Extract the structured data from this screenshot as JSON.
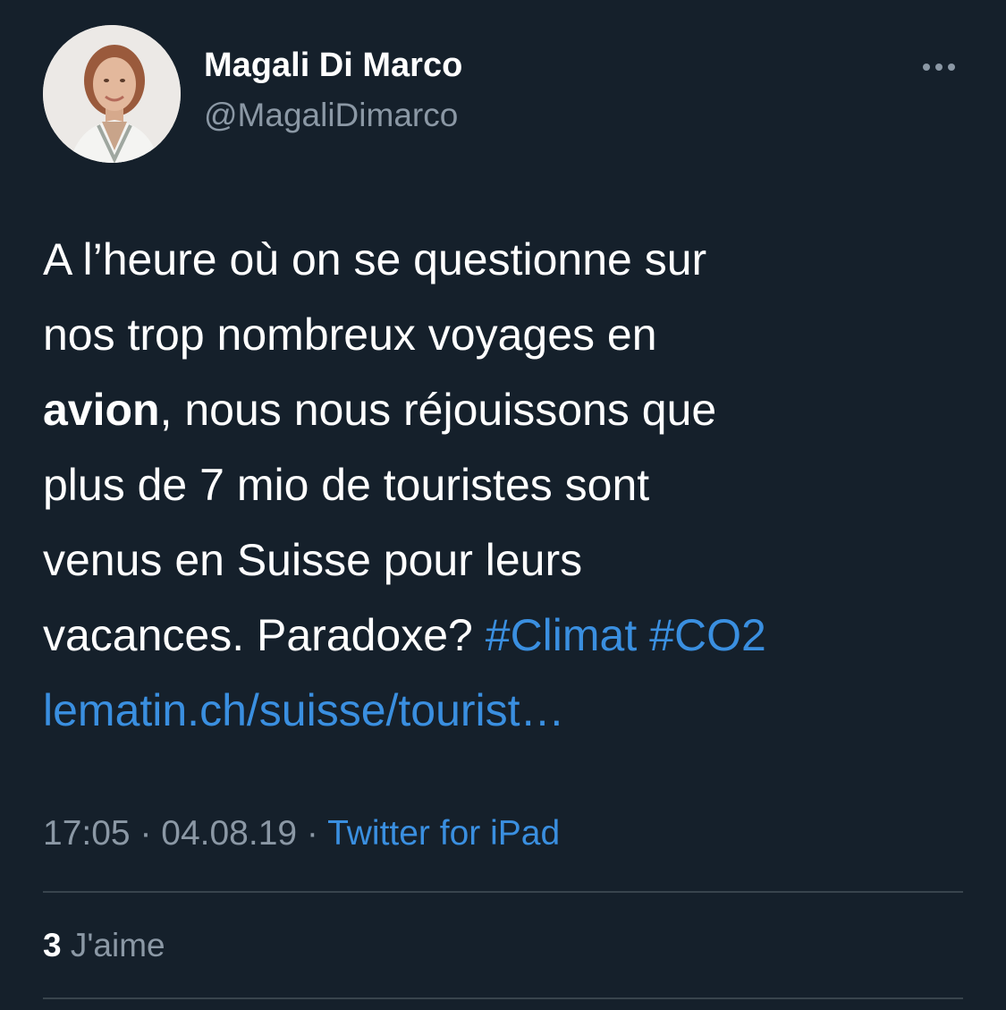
{
  "author": {
    "name": "Magali Di Marco",
    "handle": "@MagaliDimarco"
  },
  "tweet": {
    "lines": [
      {
        "text": "A l’heure où on se questionne sur"
      },
      {
        "text": "nos trop nombreux voyages en"
      },
      {
        "bold": "avion",
        "text": ", nous nous réjouissons que"
      },
      {
        "text": "plus de 7 mio de touristes sont"
      },
      {
        "text": "venus en Suisse pour leurs"
      },
      {
        "text": "vacances. Paradoxe? ",
        "hashtag1": "#Climat",
        "hashtag2": "#CO2"
      },
      {
        "link": "lematin.ch/suisse/tourist…"
      }
    ]
  },
  "meta": {
    "time": "17:05",
    "separator": " · ",
    "date": "04.08.19",
    "source": "Twitter for iPad"
  },
  "likes": {
    "count": "3",
    "label": "J'aime"
  },
  "colors": {
    "background": "#15202b",
    "link": "#3a8fe0",
    "secondary_text": "#8b98a5",
    "divider": "#38444d"
  },
  "icons": {
    "more": "more-horizontal-icon"
  }
}
